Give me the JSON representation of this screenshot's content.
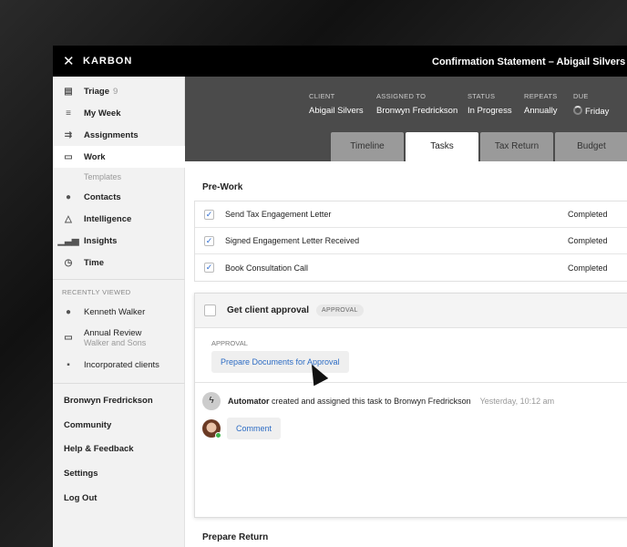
{
  "window": {
    "close": "✕",
    "brand": "KARBON",
    "title": "Confirmation Statement – Abigail Silvers"
  },
  "sidebar": {
    "items": [
      {
        "label": "Triage",
        "count": "9",
        "icon": "triage-icon"
      },
      {
        "label": "My Week",
        "icon": "week-icon"
      },
      {
        "label": "Assignments",
        "icon": "assignments-icon"
      },
      {
        "label": "Work",
        "icon": "briefcase-icon"
      },
      {
        "label": "Contacts",
        "icon": "person-icon"
      },
      {
        "label": "Intelligence",
        "icon": "network-icon"
      },
      {
        "label": "Insights",
        "icon": "bar-chart-icon"
      },
      {
        "label": "Time",
        "icon": "clock-icon"
      }
    ],
    "templates": "Templates",
    "recent_label": "RECENTLY VIEWED",
    "recent": [
      {
        "label": "Kenneth Walker"
      },
      {
        "label": "Annual Review",
        "sub": "Walker and Sons"
      },
      {
        "label": "Incorporated clients"
      }
    ],
    "footer": [
      "Bronwyn Fredrickson",
      "Community",
      "Help & Feedback",
      "Settings",
      "Log Out"
    ]
  },
  "header": {
    "meta": [
      {
        "label": "CLIENT",
        "value": "Abigail Silvers"
      },
      {
        "label": "ASSIGNED TO",
        "value": "Bronwyn Fredrickson"
      },
      {
        "label": "STATUS",
        "value": "In Progress"
      },
      {
        "label": "REPEATS",
        "value": "Annually"
      },
      {
        "label": "DUE",
        "value": "Friday"
      }
    ],
    "tabs": [
      "Timeline",
      "Tasks",
      "Tax Return",
      "Budget"
    ],
    "active_tab": "Tasks"
  },
  "main": {
    "section1": "Pre-Work",
    "tasks": [
      {
        "name": "Send Tax Engagement Letter",
        "status": "Completed"
      },
      {
        "name": "Signed Engagement Letter Received",
        "status": "Completed"
      },
      {
        "name": "Book Consultation Call",
        "status": "Completed"
      }
    ],
    "card": {
      "title": "Get client approval",
      "badge": "APPROVAL",
      "approval_label": "APPROVAL",
      "approval_button": "Prepare Documents for Approval",
      "activity_actor": "Automator",
      "activity_text": " created and assigned this task to Bronwyn Fredrickson",
      "activity_time": "Yesterday, 10:12 am",
      "comment": "Comment"
    },
    "section2": "Prepare Return"
  }
}
